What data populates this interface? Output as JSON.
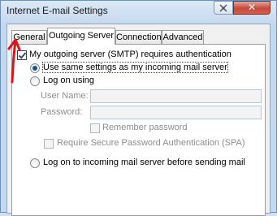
{
  "window": {
    "title": "Internet E-mail Settings"
  },
  "tabs": [
    {
      "label": "General"
    },
    {
      "label": "Outgoing Server"
    },
    {
      "label": "Connection"
    },
    {
      "label": "Advanced"
    }
  ],
  "outgoing": {
    "smtp_auth_label": "My outgoing server (SMTP) requires authentication",
    "use_same_label": "Use same settings as my incoming mail server",
    "logon_using_label": "Log on using",
    "user_name_label": "User Name:",
    "password_label": "Password:",
    "remember_password_label": "Remember password",
    "spa_label": "Require Secure Password Authentication (SPA)",
    "logon_incoming_label": "Log on to incoming mail server before sending mail"
  },
  "colors": {
    "annotation_arrow": "#e0141b",
    "title_close": "#c7493a"
  }
}
